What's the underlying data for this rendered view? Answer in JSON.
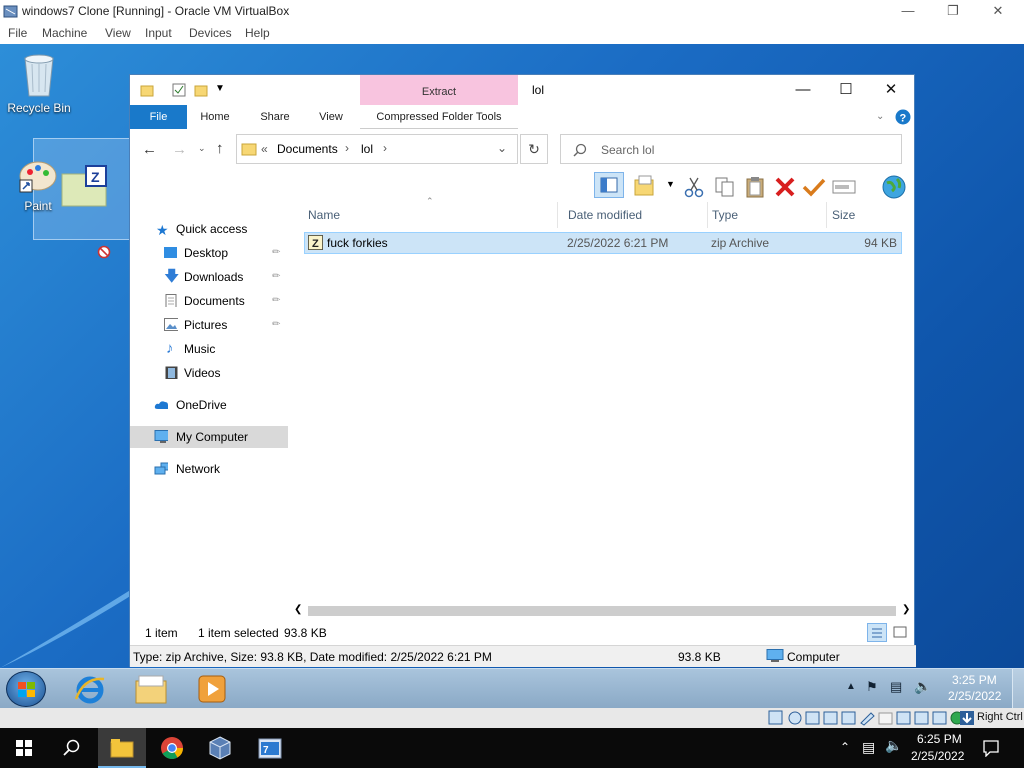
{
  "host": {
    "title": "windows7 Clone [Running] - Oracle VM VirtualBox",
    "menu": [
      "File",
      "Machine",
      "View",
      "Input",
      "Devices",
      "Help"
    ]
  },
  "desktop": {
    "icons": [
      {
        "label": "Recycle Bin"
      },
      {
        "label": "Paint"
      }
    ]
  },
  "explorer": {
    "title": "lol",
    "contextual_tab_group": "Extract",
    "contextual_tab": "Compressed Folder Tools",
    "tabs": [
      "File",
      "Home",
      "Share",
      "View"
    ],
    "address": {
      "overflow": "«",
      "crumbs": [
        "Documents",
        "lol"
      ]
    },
    "search_placeholder": "Search lol",
    "nav": {
      "quick_access": "Quick access",
      "desktop": "Desktop",
      "downloads": "Downloads",
      "documents": "Documents",
      "pictures": "Pictures",
      "music": "Music",
      "videos": "Videos",
      "onedrive": "OneDrive",
      "my_computer": "My Computer",
      "network": "Network"
    },
    "columns": {
      "name": "Name",
      "date": "Date modified",
      "type": "Type",
      "size": "Size"
    },
    "files": [
      {
        "name": "fuck forkies",
        "date": "2/25/2022 6:21 PM",
        "type": "zip Archive",
        "size": "94 KB"
      }
    ],
    "status": {
      "count": "1 item",
      "selected": "1 item selected",
      "selected_size": "93.8 KB"
    },
    "details": {
      "info": "Type: zip Archive, Size: 93.8 KB, Date modified: 2/25/2022 6:21 PM",
      "size": "93.8 KB",
      "location": "Computer"
    }
  },
  "guest_taskbar": {
    "time": "3:25 PM",
    "date": "2/25/2022"
  },
  "vbox_status": {
    "host_key": "Right Ctrl"
  },
  "host_taskbar": {
    "time": "6:25 PM",
    "date": "2/25/2022"
  },
  "colors": {
    "accent": "#1979ca",
    "selection": "#cce4f7",
    "extract_tab": "#f8c4df",
    "delete_red": "#d81e1e"
  }
}
